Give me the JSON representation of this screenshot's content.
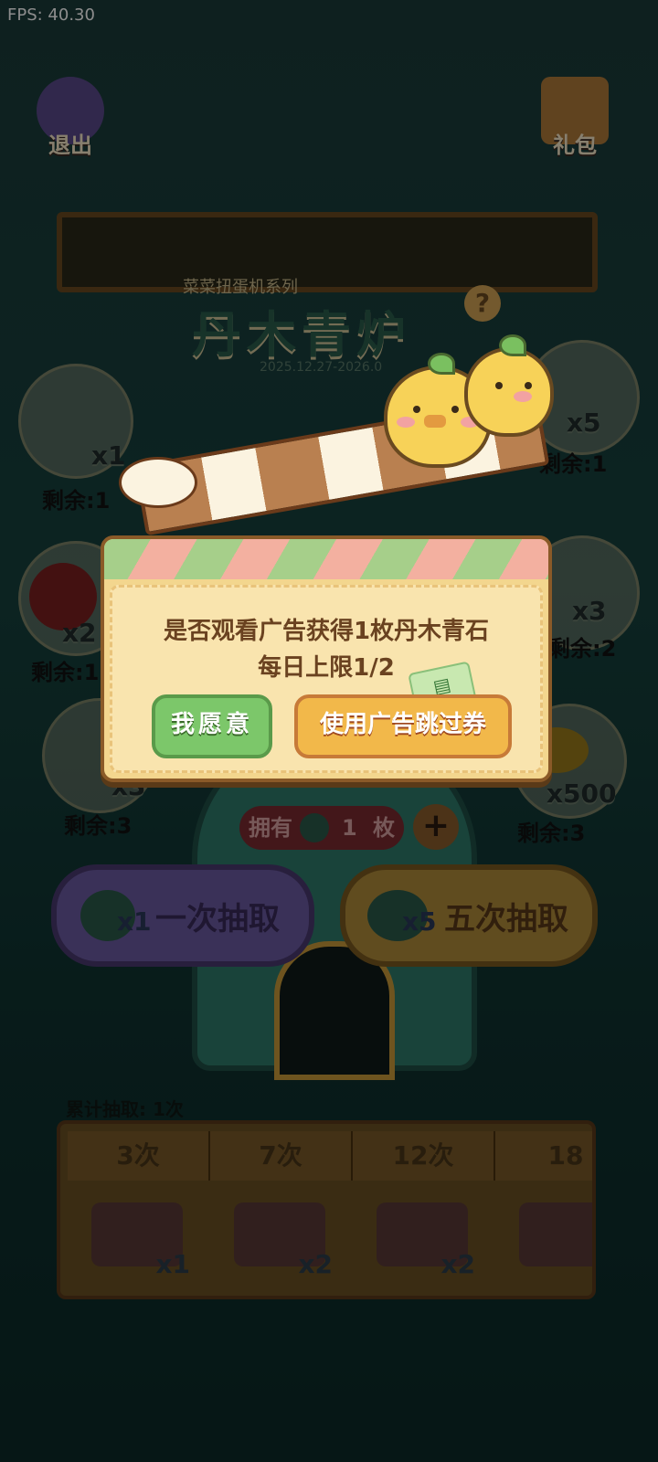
{
  "fps": "FPS: 40.30",
  "top": {
    "exit": "退出",
    "gift": "礼包"
  },
  "header": {
    "subtitle": "菜菜扭蛋机系列",
    "title": "丹木青炉",
    "date": "2025.12.27-2026.0"
  },
  "left_prizes": [
    {
      "mult": "x1",
      "remain": "剩余:1"
    },
    {
      "mult": "x2",
      "remain": "剩余:1"
    },
    {
      "mult": "x3",
      "remain": "剩余:3"
    }
  ],
  "right_prizes": [
    {
      "mult": "x5",
      "remain": "剩余:1"
    },
    {
      "mult": "x3",
      "remain": "剩余:2"
    },
    {
      "mult": "x500",
      "remain": "剩余:3"
    }
  ],
  "own": {
    "label": "拥有",
    "count": "1",
    "unit": "枚"
  },
  "draw": {
    "one": {
      "mult": "x1",
      "label": "一次抽取"
    },
    "five": {
      "mult": "x5",
      "label": "五次抽取"
    }
  },
  "cumulative": {
    "label": "累计抽取: 1次",
    "tiers": [
      {
        "count": "3次",
        "reward": "x1"
      },
      {
        "count": "7次",
        "reward": "x2"
      },
      {
        "count": "12次",
        "reward": "x2"
      },
      {
        "count": "18",
        "reward": ""
      }
    ]
  },
  "modal": {
    "line1": "是否观看广告获得1枚丹木青石",
    "line2": "每日上限1/2",
    "yes": "我愿意",
    "skip": "使用广告跳过券"
  }
}
